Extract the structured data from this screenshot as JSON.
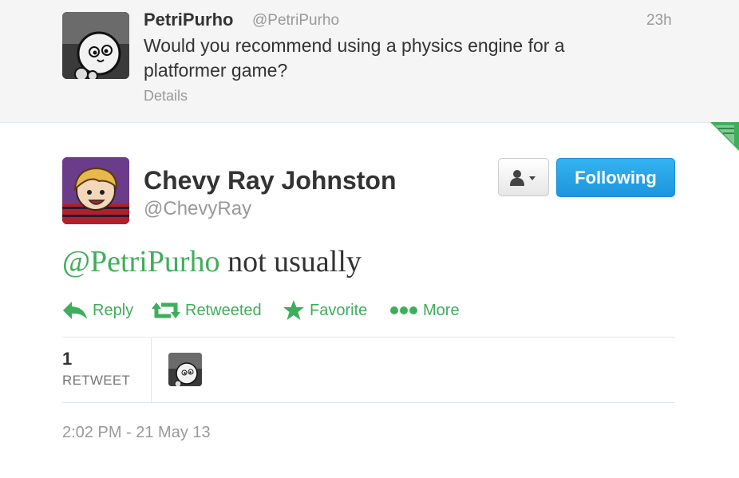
{
  "parent_tweet": {
    "name": "PetriPurho",
    "handle": "@PetriPurho",
    "time": "23h",
    "text": "Would you recommend using a physics engine for a platformer game?",
    "details": "Details"
  },
  "tweet": {
    "name": "Chevy Ray Johnston",
    "handle": "@ChevyRay",
    "mention": "@PetriPurho",
    "text": " not usually",
    "timestamp": "2:02 PM - 21 May 13"
  },
  "buttons": {
    "user_actions_icon": "person-dropdown-icon",
    "follow_label": "Following"
  },
  "actions": [
    {
      "icon": "reply-icon",
      "label": "Reply"
    },
    {
      "icon": "retweet-icon",
      "label": "Retweeted"
    },
    {
      "icon": "star-icon",
      "label": "Favorite"
    },
    {
      "icon": "more-dots-icon",
      "label": "More"
    }
  ],
  "stats": {
    "retweet_count": "1",
    "retweet_label": "RETWEET"
  },
  "colors": {
    "accent_green": "#3fae5b",
    "follow_blue": "#1c95dd",
    "muted": "#999999"
  }
}
